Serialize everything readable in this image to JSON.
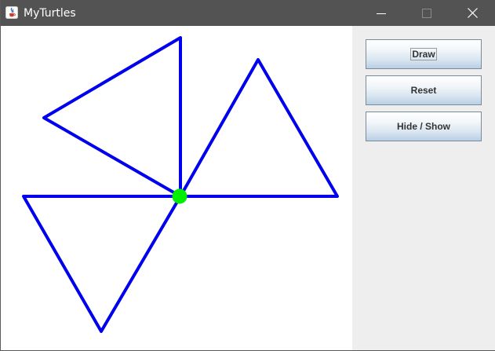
{
  "window": {
    "title": "MyTurtles",
    "controls": [
      "minimize",
      "maximize",
      "close"
    ]
  },
  "panel": {
    "buttons": [
      {
        "label": "Draw",
        "focused": true
      },
      {
        "label": "Reset",
        "focused": false
      },
      {
        "label": "Hide / Show",
        "focused": false
      }
    ]
  },
  "drawing": {
    "line_color": "#0000ee",
    "turtle_color": "#00ee00",
    "shapes": [
      "triangle-upper-left",
      "triangle-upper-right",
      "triangle-lower-left"
    ]
  },
  "colors": {
    "titlebar": "#535353",
    "canvas": "#ffffff",
    "panel": "#eeeeee"
  }
}
